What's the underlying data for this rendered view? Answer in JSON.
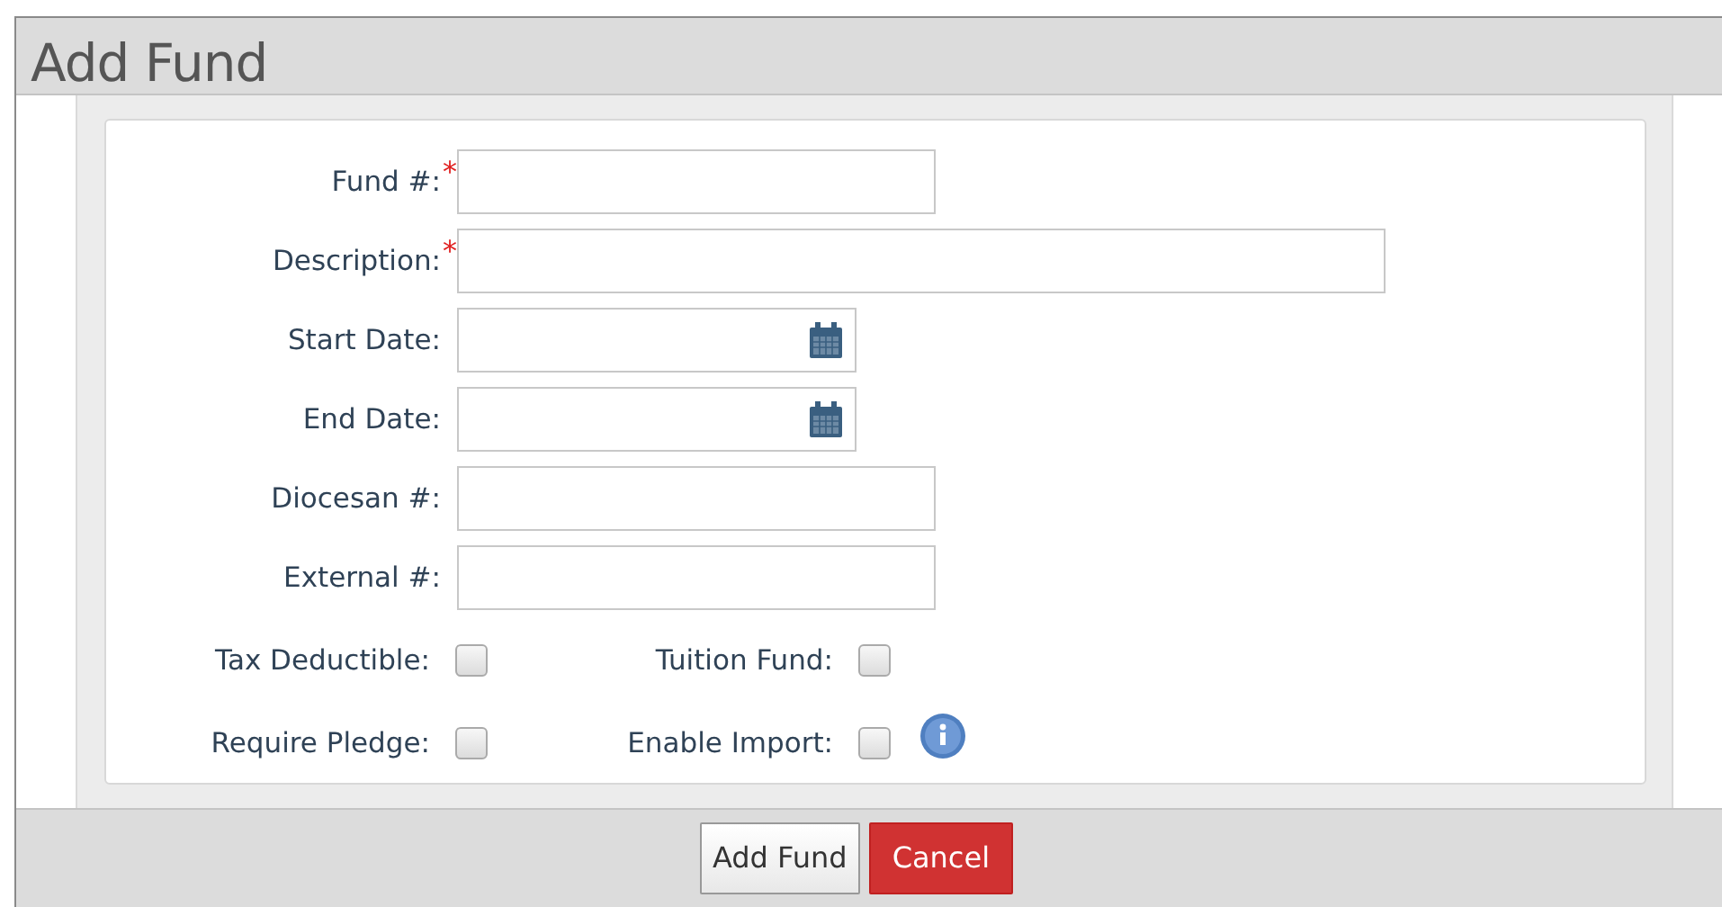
{
  "dialog": {
    "title": "Add Fund"
  },
  "fields": [
    {
      "label": "Fund #:",
      "required_mark": "*",
      "kind": "text"
    },
    {
      "label": "Description:",
      "required_mark": "*",
      "kind": "text"
    },
    {
      "label": "Start Date:",
      "kind": "date"
    },
    {
      "label": "End Date:",
      "kind": "date"
    },
    {
      "label": "Diocesan #:",
      "kind": "text"
    },
    {
      "label": "External #:",
      "kind": "text"
    }
  ],
  "checkbox_rows": [
    [
      {
        "label": "Tax Deductible:",
        "checked": false
      },
      {
        "label": "Tuition Fund:",
        "checked": false
      }
    ],
    [
      {
        "label": "Require Pledge:",
        "checked": false
      },
      {
        "label": "Enable Import:",
        "checked": false,
        "info": true
      }
    ]
  ],
  "buttons": [
    {
      "label": "Add Fund",
      "kind": "default"
    },
    {
      "label": "Cancel",
      "kind": "danger"
    }
  ]
}
